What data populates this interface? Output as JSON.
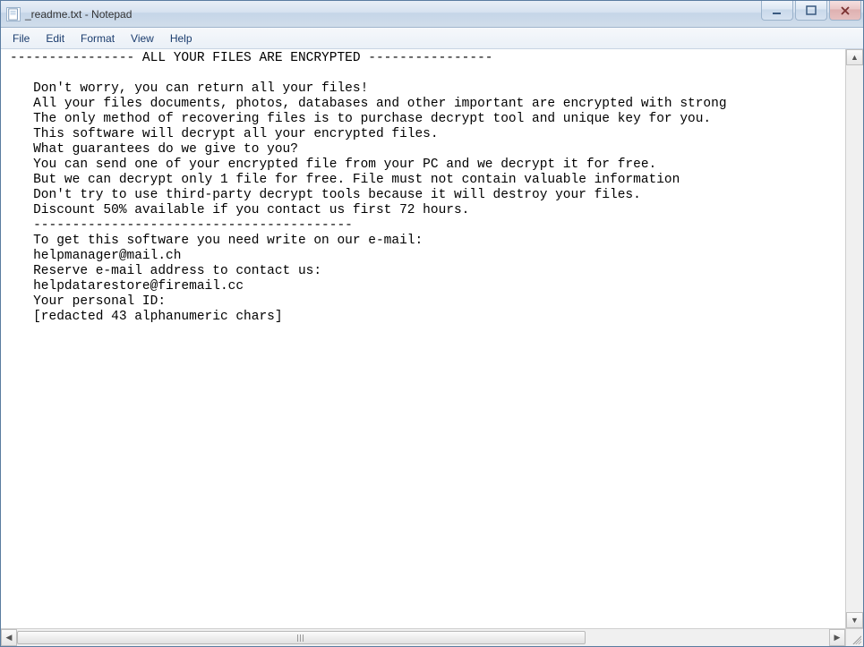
{
  "window": {
    "title": "_readme.txt - Notepad"
  },
  "menubar": {
    "items": [
      {
        "label": "File"
      },
      {
        "label": "Edit"
      },
      {
        "label": "Format"
      },
      {
        "label": "View"
      },
      {
        "label": "Help"
      }
    ]
  },
  "document": {
    "text": "---------------- ALL YOUR FILES ARE ENCRYPTED ----------------\n\n   Don't worry, you can return all your files!\n   All your files documents, photos, databases and other important are encrypted with strong\n   The only method of recovering files is to purchase decrypt tool and unique key for you.\n   This software will decrypt all your encrypted files.\n   What guarantees do we give to you?\n   You can send one of your encrypted file from your PC and we decrypt it for free.\n   But we can decrypt only 1 file for free. File must not contain valuable information\n   Don't try to use third-party decrypt tools because it will destroy your files.\n   Discount 50% available if you contact us first 72 hours.\n   -----------------------------------------\n   To get this software you need write on our e-mail:\n   helpmanager@mail.ch\n   Reserve e-mail address to contact us:\n   helpdatarestore@firemail.cc\n   Your personal ID:\n   [redacted 43 alphanumeric chars]"
  }
}
